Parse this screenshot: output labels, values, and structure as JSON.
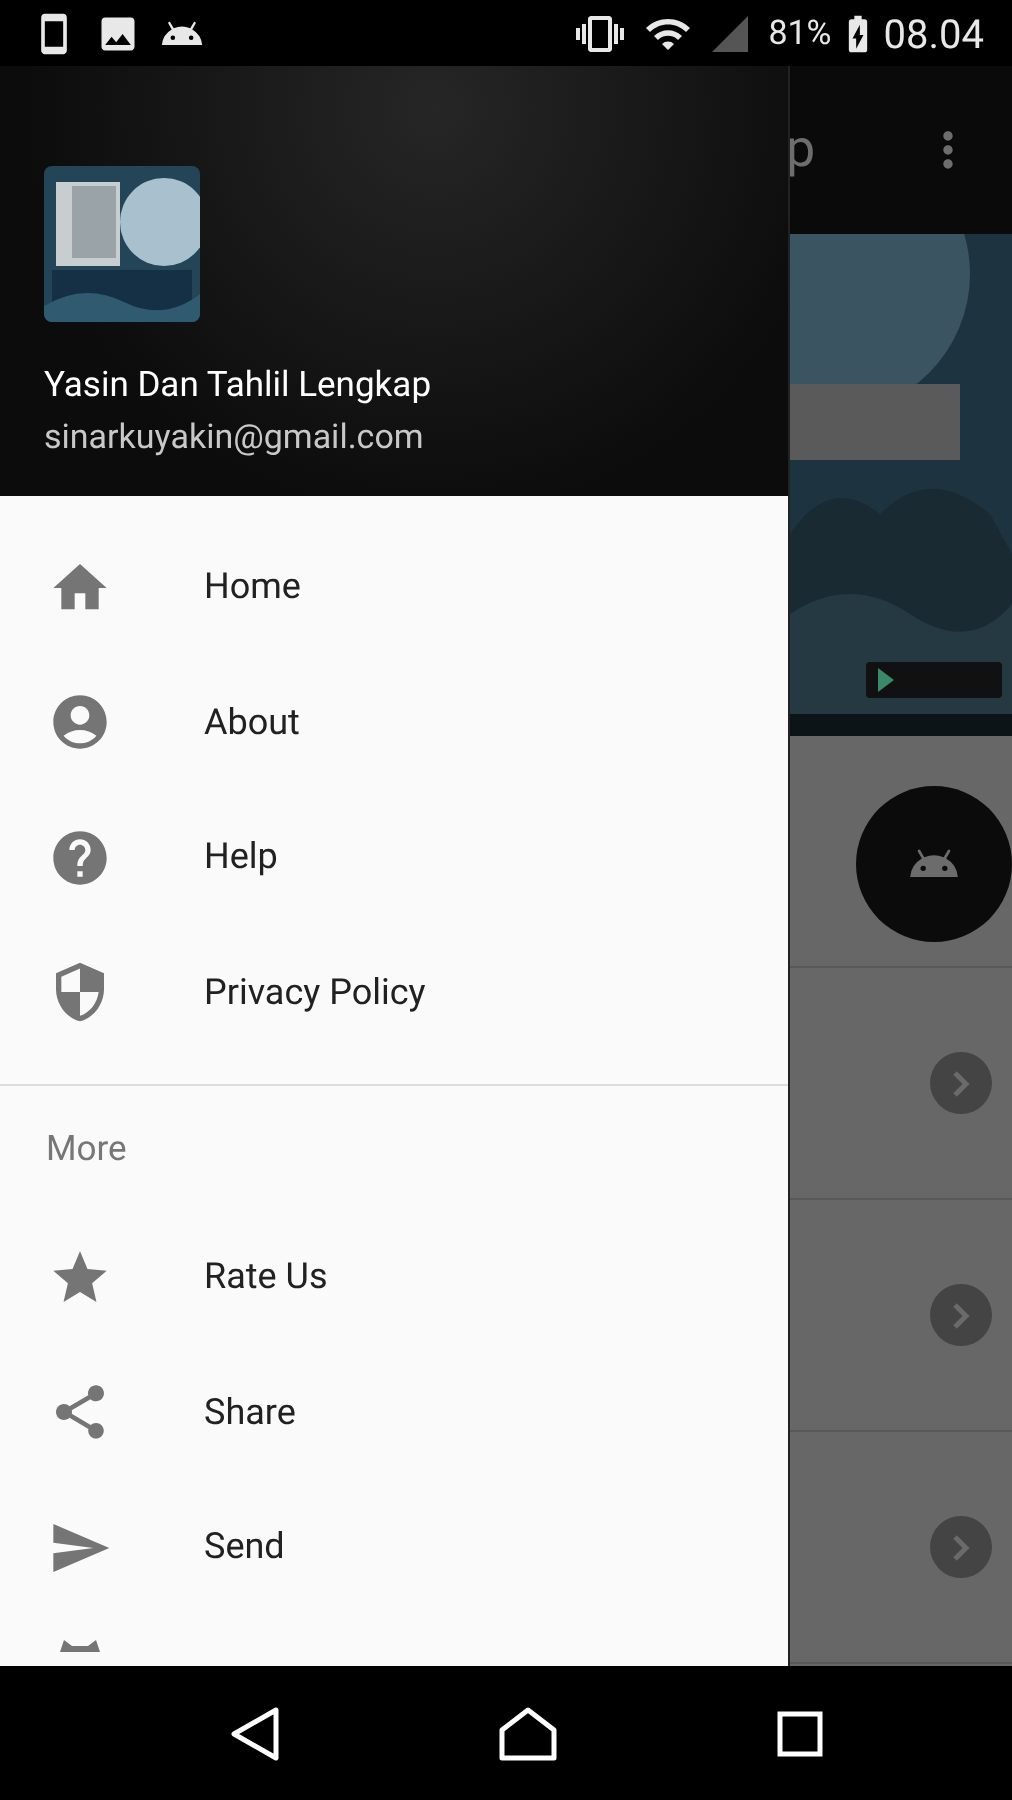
{
  "status_bar": {
    "battery": "81%",
    "time": "08.04"
  },
  "app_bar": {
    "title": "p"
  },
  "drawer": {
    "header": {
      "name": "Yasin Dan Tahlil Lengkap",
      "email": "sinarkuyakin@gmail.com"
    },
    "items": [
      {
        "label": "Home"
      },
      {
        "label": "About"
      },
      {
        "label": "Help"
      },
      {
        "label": "Privacy Policy"
      }
    ],
    "section": {
      "title": "More",
      "items": [
        {
          "label": "Rate Us"
        },
        {
          "label": "Share"
        },
        {
          "label": "Send"
        }
      ]
    }
  }
}
